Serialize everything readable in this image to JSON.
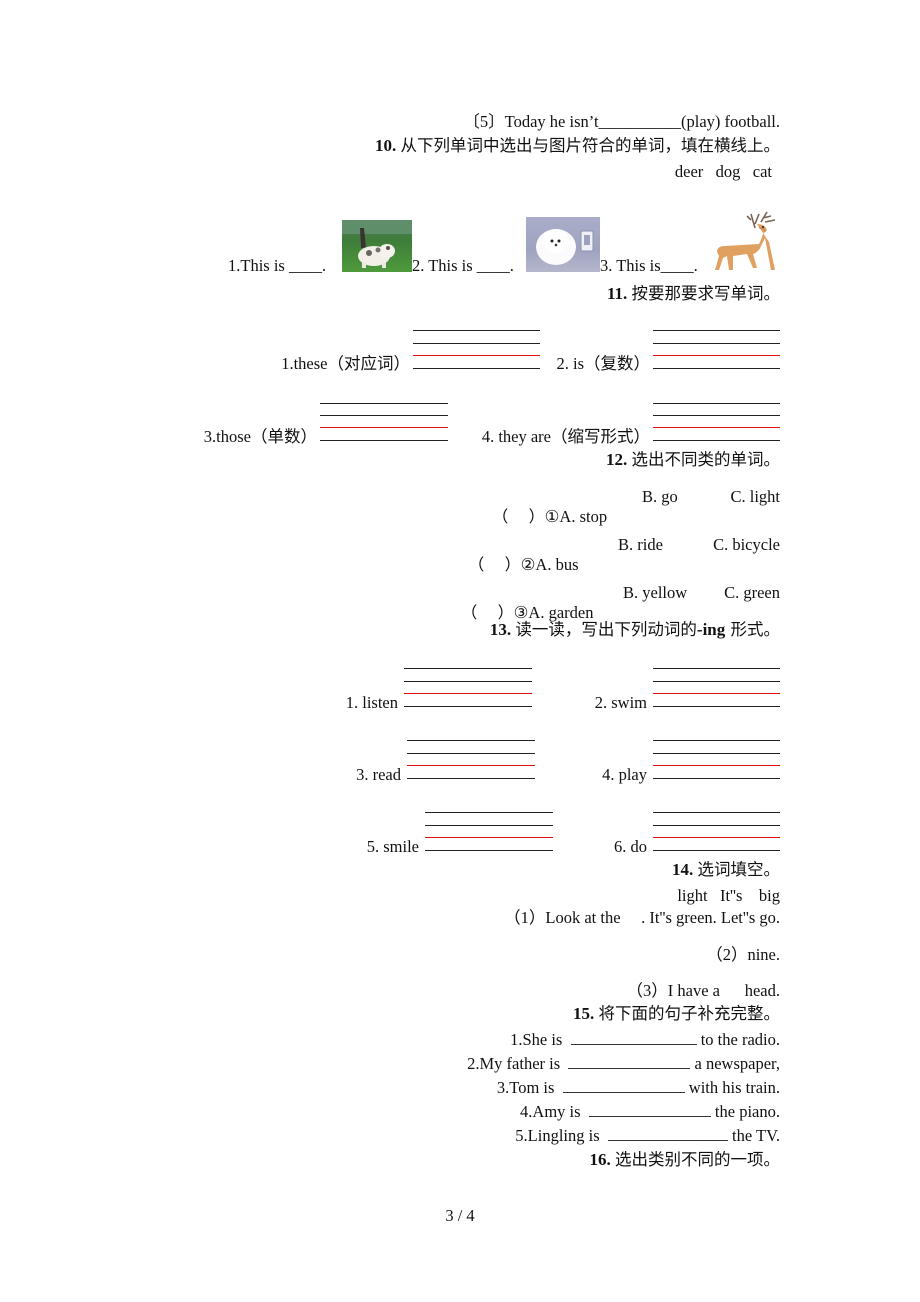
{
  "document": {
    "q9_item5": "〔5〕Today he isn’t__________(play) football.",
    "q10": {
      "number": "10.",
      "instruction": "从下列单词中选出与图片符合的单词，填在横线上。",
      "word_bank": "deer   dog   cat",
      "items": [
        {
          "text": "1.This is ____.",
          "image": "cat-photo"
        },
        {
          "text": "2. This is ____.",
          "image": "dog-photo"
        },
        {
          "text": "3. This is____.",
          "image": "deer-illustration"
        }
      ]
    },
    "q11": {
      "number": "11.",
      "instruction": "按要那要求写单词。",
      "items": [
        {
          "label": "1.these（对应词）"
        },
        {
          "label": "2. is（复数）"
        },
        {
          "label": "3.those（单数）"
        },
        {
          "label": "4. they are（缩写形式）"
        }
      ]
    },
    "q12": {
      "number": "12.",
      "instruction": "选出不同类的单词。",
      "items": [
        {
          "bracket": "（    ）",
          "num": "①",
          "a": "A. stop",
          "b": "B. go",
          "c": "C. light"
        },
        {
          "bracket": "（    ）",
          "num": "②",
          "a": "A. bus",
          "b": "B. ride",
          "c": "C. bicycle"
        },
        {
          "bracket": "（    ）",
          "num": "③",
          "a": "A. garden",
          "b": "B. yellow",
          "c": "C. green"
        }
      ]
    },
    "q13": {
      "number": "13.",
      "instruction_pre": "读一读，写出下列动词的",
      "instruction_bold": "-ing",
      "instruction_post": " 形式。",
      "items": [
        {
          "label": "1. listen"
        },
        {
          "label": "2. swim"
        },
        {
          "label": "3. read"
        },
        {
          "label": "4. play"
        },
        {
          "label": "5. smile"
        },
        {
          "label": "6. do"
        }
      ]
    },
    "q14": {
      "number": "14.",
      "instruction": "选词填空。",
      "word_bank": "light   It''s    big",
      "items": [
        "（1）Look at the     . It''s green. Let''s go.",
        "（2）nine.",
        "（3）I have a      head."
      ]
    },
    "q15": {
      "number": "15.",
      "instruction": "将下面的句子补充完整。",
      "items": [
        {
          "before": "1.She is",
          "after": "to the radio."
        },
        {
          "before": "2.My father is",
          "after": "a newspaper,"
        },
        {
          "before": "3.Tom is",
          "after": "with his train."
        },
        {
          "before": "4.Amy is",
          "after": "the piano."
        },
        {
          "before": "5.Lingling is",
          "after": "the TV."
        }
      ]
    },
    "q16": {
      "number": "16.",
      "instruction": "选出类别不同的一项。"
    },
    "page_number": "3 / 4"
  },
  "colors": {
    "guide_line": "#222222",
    "guide_line_red": "#e01010"
  }
}
